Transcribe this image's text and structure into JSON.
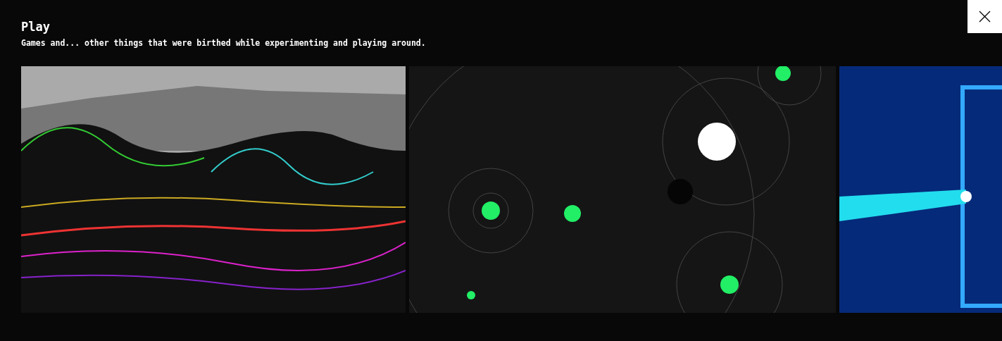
{
  "header": {
    "title": "Play",
    "subtitle": "Games and... other things that were birthed while experimenting and playing around."
  },
  "gallery": [
    {
      "kind": "terrain"
    },
    {
      "kind": "space"
    },
    {
      "kind": "arcade"
    }
  ]
}
